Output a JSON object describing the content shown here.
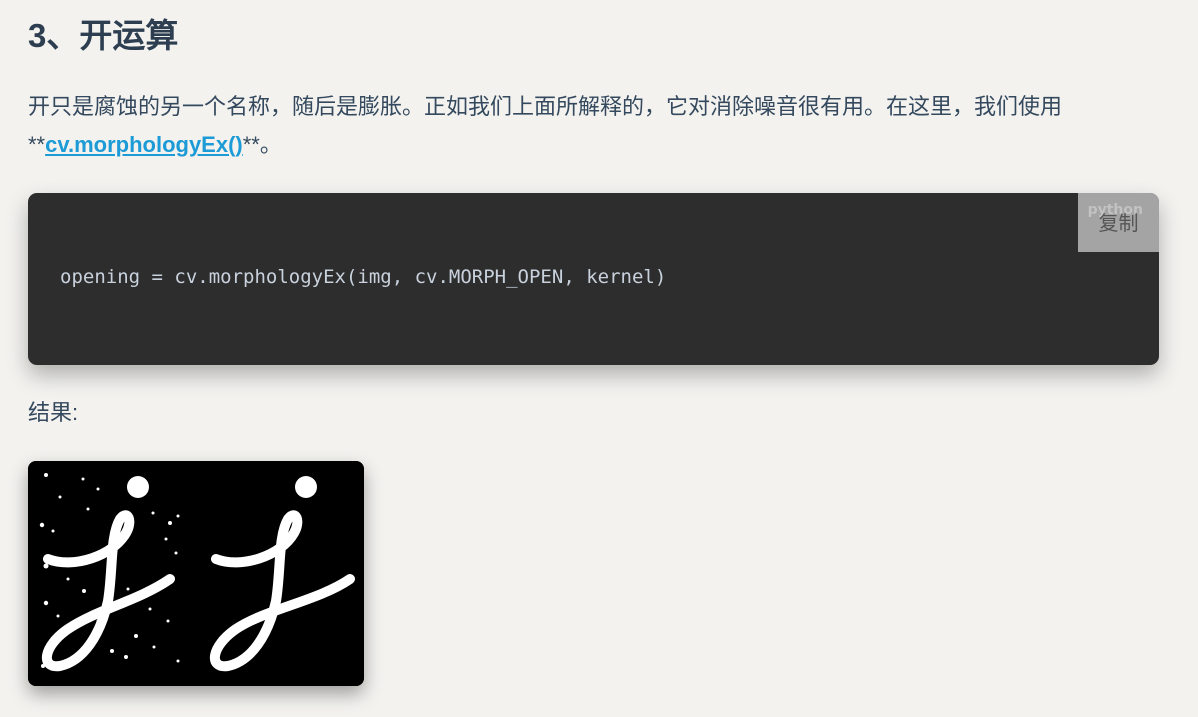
{
  "section": {
    "heading": "3、开运算"
  },
  "paragraph": {
    "text_before": "开只是腐蚀的另一个名称，随后是膨胀。正如我们上面所解释的，它对消除噪音很有用。在这里，我们使用",
    "marker_before": "**",
    "link_text": "cv.morphologyEx()",
    "marker_after": "**。"
  },
  "code_block": {
    "language": "python",
    "copy_label": "复制",
    "code": "opening = cv.morphologyEx(img, cv.MORPH_OPEN, kernel)"
  },
  "result": {
    "label": "结果:"
  },
  "colors": {
    "page_background": "#f3f2ef",
    "text": "#34495e",
    "link": "#1d9bd6",
    "code_background": "#2d2d2d",
    "code_text": "#c8d1dc"
  }
}
